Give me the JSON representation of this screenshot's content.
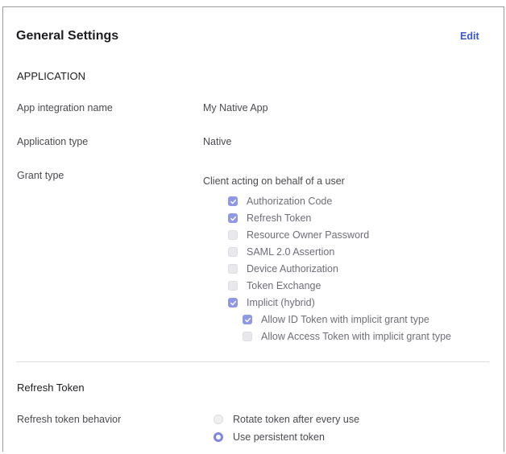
{
  "header": {
    "title": "General Settings",
    "edit_label": "Edit"
  },
  "application": {
    "section_title": "APPLICATION",
    "fields": [
      {
        "label": "App integration name",
        "value": "My Native App"
      },
      {
        "label": "Application type",
        "value": "Native"
      }
    ],
    "grant_type": {
      "label": "Grant type",
      "heading": "Client acting on behalf of a user",
      "options": [
        {
          "label": "Authorization Code",
          "checked": true
        },
        {
          "label": "Refresh Token",
          "checked": true
        },
        {
          "label": "Resource Owner Password",
          "checked": false
        },
        {
          "label": "SAML 2.0 Assertion",
          "checked": false
        },
        {
          "label": "Device Authorization",
          "checked": false
        },
        {
          "label": "Token Exchange",
          "checked": false
        },
        {
          "label": "Implicit (hybrid)",
          "checked": true
        }
      ],
      "sub_options": [
        {
          "label": "Allow ID Token with implicit grant type",
          "checked": true
        },
        {
          "label": "Allow Access Token with implicit grant type",
          "checked": false
        }
      ]
    }
  },
  "refresh_token": {
    "section_title": "Refresh Token",
    "behavior_label": "Refresh token behavior",
    "options": [
      {
        "label": "Rotate token after every use",
        "selected": false
      },
      {
        "label": "Use persistent token",
        "selected": true
      }
    ]
  },
  "colors": {
    "accent": "#3a55c8",
    "checkbox_on": "#8f98e6",
    "radio_on": "#7e88e2",
    "border": "#9a9a9f"
  }
}
